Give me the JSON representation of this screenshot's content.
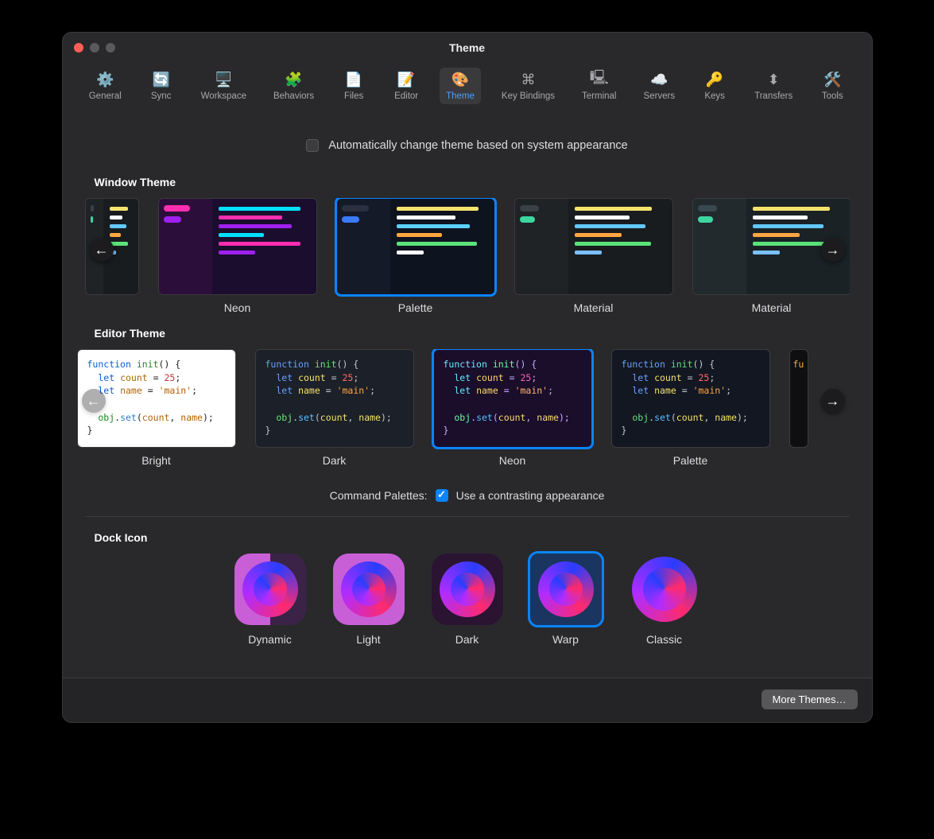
{
  "title": "Theme",
  "toolbar": [
    {
      "label": "General",
      "icon": "⚙️"
    },
    {
      "label": "Sync",
      "icon": "🔄"
    },
    {
      "label": "Workspace",
      "icon": "🖥️"
    },
    {
      "label": "Behaviors",
      "icon": "🧩"
    },
    {
      "label": "Files",
      "icon": "📄"
    },
    {
      "label": "Editor",
      "icon": "📝"
    },
    {
      "label": "Theme",
      "icon": "🎨",
      "selected": true
    },
    {
      "label": "Key Bindings",
      "icon": "⌘"
    },
    {
      "label": "Terminal",
      "icon": "🖳"
    },
    {
      "label": "Servers",
      "icon": "☁️"
    },
    {
      "label": "Keys",
      "icon": "🔑"
    },
    {
      "label": "Transfers",
      "icon": "⬍"
    },
    {
      "label": "Tools",
      "icon": "🛠️"
    }
  ],
  "auto_change_label": "Automatically change theme based on system appearance",
  "auto_change_checked": false,
  "window_theme": {
    "heading": "Window Theme",
    "items": [
      {
        "name": "",
        "cls": "first mat"
      },
      {
        "name": "Neon",
        "cls": "neon"
      },
      {
        "name": "Palette",
        "cls": "pal",
        "selected": true
      },
      {
        "name": "Material",
        "cls": "mat"
      },
      {
        "name": "Material",
        "cls": "mat2"
      }
    ]
  },
  "editor_theme": {
    "heading": "Editor Theme",
    "items": [
      {
        "name": "Bright",
        "cls": "ed-bright"
      },
      {
        "name": "Dark",
        "cls": "ed-dark"
      },
      {
        "name": "Neon",
        "cls": "ed-neon",
        "selected": true
      },
      {
        "name": "Palette",
        "cls": "ed-pal"
      },
      {
        "name": "",
        "cls": "ed-extra"
      }
    ],
    "code": {
      "kw1": "function",
      "fn": "init",
      "p1": "() {",
      "kw2": "let",
      "v1": "count",
      "eq": " = ",
      "n1": "25",
      "sc": ";",
      "kw3": "let",
      "v2": "name",
      "str": "'main'",
      "obj": "obj",
      "dot": ".",
      "mtd": "set",
      "args": "(",
      "a1": "count",
      ", ": "",
      "a2": "name",
      ")": "",
      ";": "",
      "close": "}"
    }
  },
  "cmd_palette_label": "Command Palettes:",
  "cmd_palette_checkbox_label": "Use a contrasting appearance",
  "cmd_palette_checked": true,
  "dock": {
    "heading": "Dock Icon",
    "items": [
      {
        "name": "Dynamic",
        "cls": "di-dynamic"
      },
      {
        "name": "Light",
        "cls": "di-light"
      },
      {
        "name": "Dark",
        "cls": "di-dark"
      },
      {
        "name": "Warp",
        "cls": "di-warp",
        "selected": true
      },
      {
        "name": "Classic",
        "cls": "di-classic"
      }
    ]
  },
  "more_button": "More Themes…"
}
